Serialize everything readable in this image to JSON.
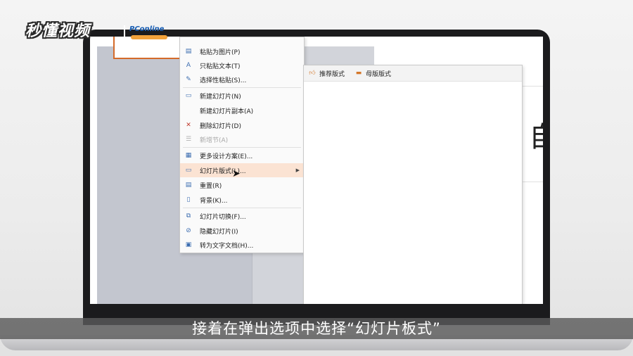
{
  "branding": {
    "logo_text": "秒懂视频",
    "partner_text": "PConline"
  },
  "context_menu": {
    "items": [
      {
        "label": "粘贴为图片(P)",
        "icon": "paste-image-icon",
        "disabled": false
      },
      {
        "label": "只粘贴文本(T)",
        "icon": "paste-text-icon",
        "disabled": false
      },
      {
        "label": "选择性粘贴(S)...",
        "icon": "paste-special-icon",
        "disabled": false
      },
      {
        "label": "新建幻灯片(N)",
        "icon": "new-slide-icon",
        "disabled": false
      },
      {
        "label": "新建幻灯片副本(A)",
        "icon": "",
        "disabled": false
      },
      {
        "label": "删除幻灯片(D)",
        "icon": "delete-slide-icon",
        "disabled": false
      },
      {
        "label": "新增节(A)",
        "icon": "section-icon",
        "disabled": true
      },
      {
        "label": "更多设计方案(E)...",
        "icon": "design-icon",
        "disabled": false
      },
      {
        "label": "幻灯片版式(L)...",
        "icon": "layout-icon",
        "disabled": false,
        "highlighted": true,
        "has_submenu": true
      },
      {
        "label": "重置(R)",
        "icon": "reset-icon",
        "disabled": false
      },
      {
        "label": "背景(K)...",
        "icon": "background-icon",
        "disabled": false
      },
      {
        "label": "幻灯片切换(F)...",
        "icon": "transition-icon",
        "disabled": false
      },
      {
        "label": "隐藏幻灯片(I)",
        "icon": "hide-slide-icon",
        "disabled": false
      },
      {
        "label": "转为文字文档(H)...",
        "icon": "convert-doc-icon",
        "disabled": false
      }
    ]
  },
  "submenu": {
    "tabs": [
      {
        "label": "推荐版式",
        "icon": "thumbs-up-icon"
      },
      {
        "label": "母版版式",
        "icon": "master-layout-icon"
      }
    ]
  },
  "slide_glyph": "自",
  "subtitle": "接着在弹出选项中选择“幻灯片板式”",
  "colors": {
    "highlight": "#fbe3d3",
    "accent_orange": "#d46a2a",
    "panel_gray": "#c3c6cf"
  }
}
